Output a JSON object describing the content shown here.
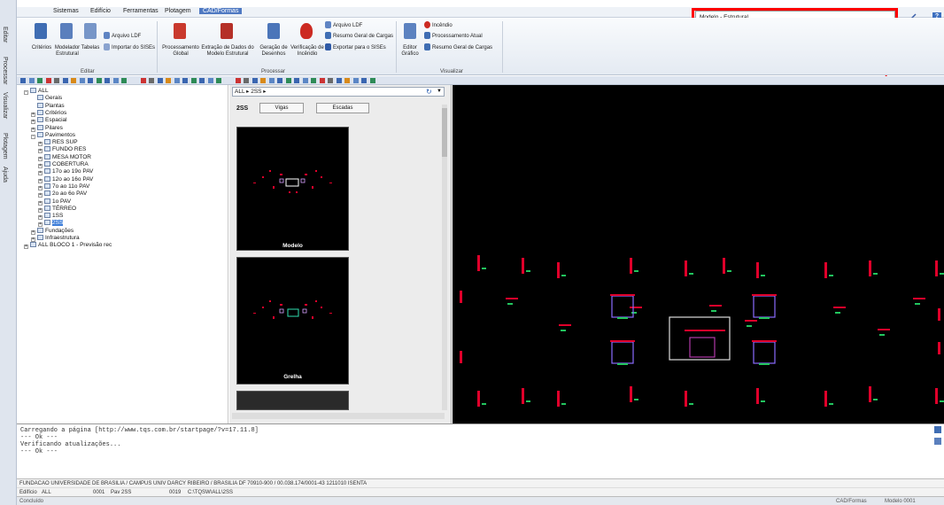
{
  "vertical_tabs": [
    "Editar",
    "Processar",
    "Visualizar",
    "Plotagem",
    "Ajuda"
  ],
  "menu": {
    "items": [
      "Sistemas",
      "Edifício",
      "Ferramentas",
      "Plotagem",
      "CAD/Formas"
    ],
    "active_index": 4
  },
  "title_field": {
    "value": "Modelo - Estrutural"
  },
  "ribbon": {
    "editar": {
      "criterios": "Critérios",
      "modelador": "Modelador Estrutural",
      "tabelas": "Tabelas",
      "arquivo_ldf": "Arquivo LDF",
      "importar": "Importar do SISEs",
      "group": "Editar"
    },
    "processar": {
      "proc_global": "Processamento Global",
      "extracao": "Extração de Dados do Modelo Estrutural",
      "geracao": "Geração de Desenhos",
      "verificacao": "Verificação de Incêndio",
      "arquivo_ldf": "Arquivo LDF",
      "resumo_cargas": "Resumo Geral de Cargas",
      "exportar": "Exportar para o SISEs",
      "group": "Processar"
    },
    "visualizar": {
      "editor": "Editor Gráfico",
      "incendio": "Incêndio",
      "proc_atual": "Processamento Atual",
      "resumo": "Resumo Geral de Cargas",
      "group": "Visualizar"
    }
  },
  "tree": [
    {
      "label": "ALL",
      "level": 0,
      "toggle": "-"
    },
    {
      "label": "Gerais",
      "level": 1,
      "toggle": ""
    },
    {
      "label": "Plantas",
      "level": 1,
      "toggle": ""
    },
    {
      "label": "Critérios",
      "level": 1,
      "toggle": "+"
    },
    {
      "label": "Espacial",
      "level": 1,
      "toggle": "+"
    },
    {
      "label": "Pilares",
      "level": 1,
      "toggle": "+"
    },
    {
      "label": "Pavimentos",
      "level": 1,
      "toggle": "-"
    },
    {
      "label": "RES SUP",
      "level": 2,
      "toggle": "+"
    },
    {
      "label": "FUNDO RES",
      "level": 2,
      "toggle": "+"
    },
    {
      "label": "MESA MOTOR",
      "level": 2,
      "toggle": "+"
    },
    {
      "label": "COBERTURA",
      "level": 2,
      "toggle": "+"
    },
    {
      "label": "17o ao 19o PAV",
      "level": 2,
      "toggle": "+"
    },
    {
      "label": "12o ao 16o PAV",
      "level": 2,
      "toggle": "+"
    },
    {
      "label": "7o ao 11o PAV",
      "level": 2,
      "toggle": "+"
    },
    {
      "label": "2o ao 6o PAV",
      "level": 2,
      "toggle": "+"
    },
    {
      "label": "1o PAV",
      "level": 2,
      "toggle": "+"
    },
    {
      "label": "TÉRREO",
      "level": 2,
      "toggle": "+"
    },
    {
      "label": "1SS",
      "level": 2,
      "toggle": "+"
    },
    {
      "label": "2SS",
      "level": 2,
      "toggle": "+",
      "selected": true
    },
    {
      "label": "Fundações",
      "level": 1,
      "toggle": "+"
    },
    {
      "label": "Infraestrutura",
      "level": 1,
      "toggle": "+"
    },
    {
      "label": "ALL BLOCO 1 - Previsão rec",
      "level": 0,
      "toggle": "+"
    }
  ],
  "thumb": {
    "breadcrumb": "ALL  ▸  2SS  ▸",
    "floor": "2SS",
    "vigas_btn": "Vigas",
    "escadas_btn": "Escadas",
    "cards": [
      "Modelo",
      "Grelha"
    ]
  },
  "console": {
    "lines": [
      "Carregando a página [http://www.tqs.com.br/startpage/?v=17.11.8]",
      "--- Ok ---",
      "Verificando atualizações...",
      "--- Ok ---"
    ]
  },
  "status": {
    "line1": "FUNDACAO UNIVERSIDADE DE BRASILIA / CAMPUS UNIV DARCY RIBEIRO / BRASILIA DF 70910-900 / 00.038.174/0001-43 1211010 ISENTA",
    "edificio_label": "Edifício",
    "edificio_value": "ALL",
    "code1": "0001",
    "pav_label": "Pav",
    "pav_value": "2SS",
    "code2": "0019",
    "path": "C:\\TQSW\\ALL\\2SS",
    "concluido": "Concluído",
    "right1": "CAD/Formas",
    "right2": "Modelo 0001"
  },
  "colors": {
    "accent": "#4f79c2",
    "highlight": "#ff0000",
    "canvas_bg": "#000000",
    "plan_red": "#e0002a",
    "plan_green": "#22c55e"
  }
}
